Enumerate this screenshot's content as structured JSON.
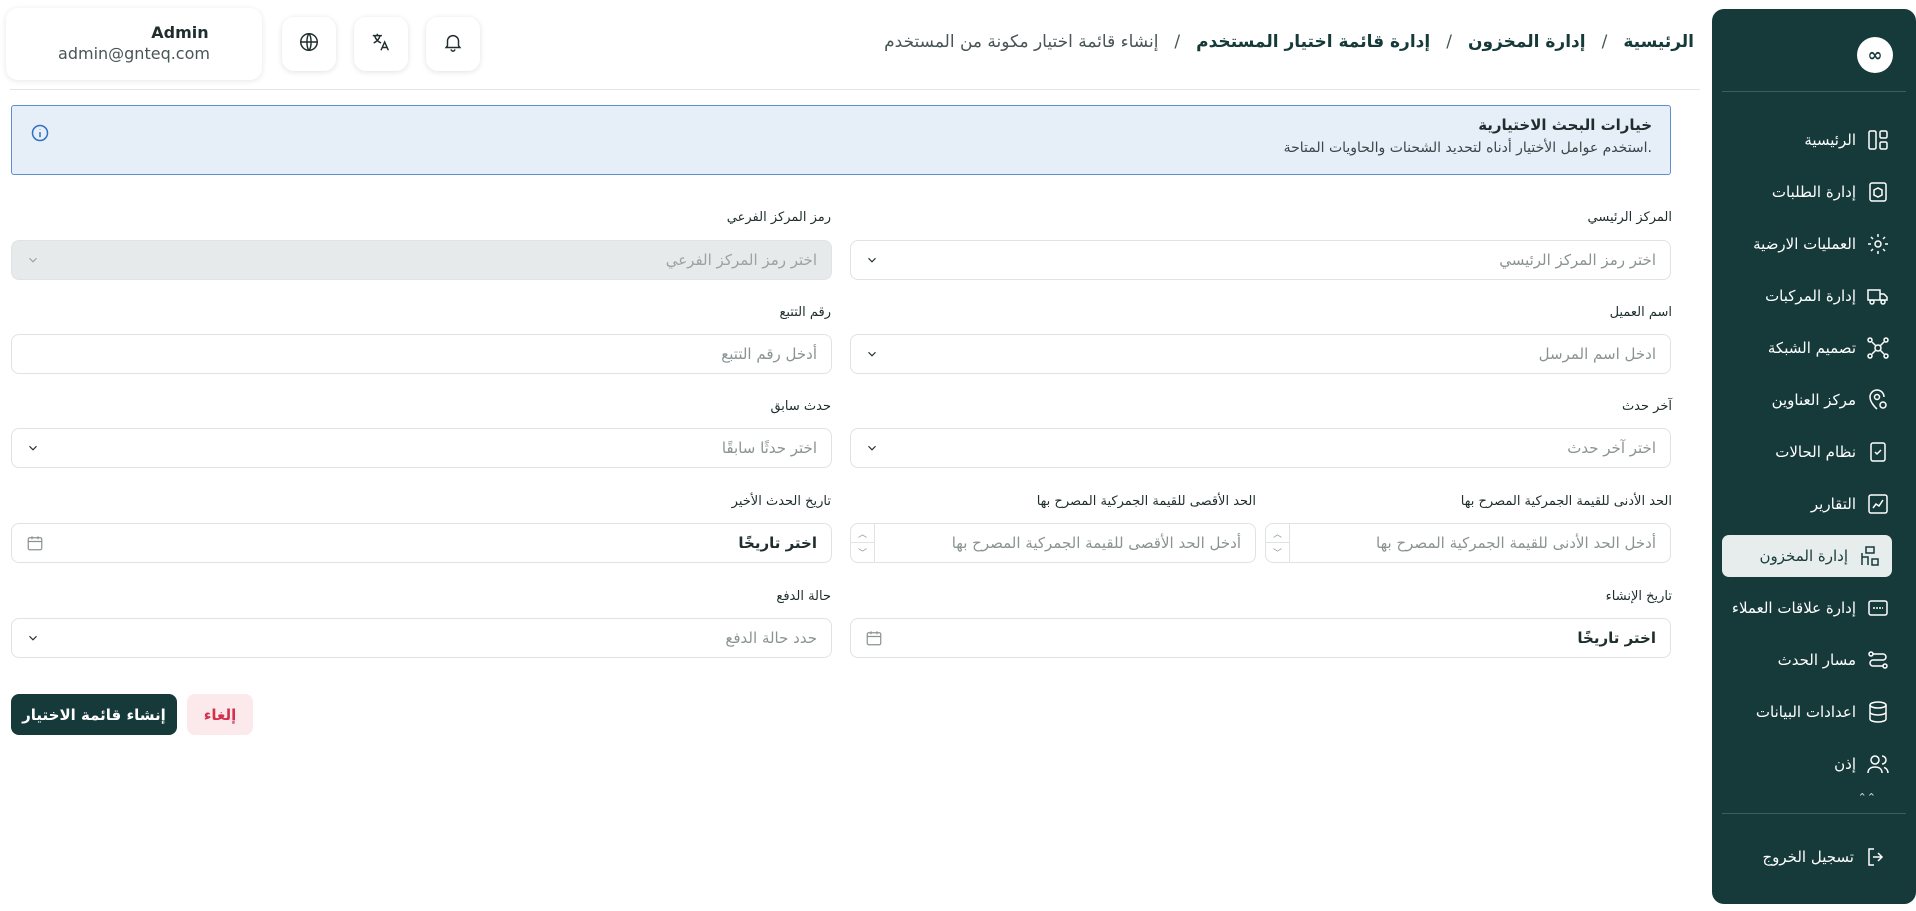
{
  "sidebar": {
    "logo": "∞",
    "items": [
      {
        "label": "الرئيسية",
        "icon": "dashboard-icon"
      },
      {
        "label": "إدارة الطلبات",
        "icon": "orders-icon"
      },
      {
        "label": "العمليات الارضية",
        "icon": "ground-operations-icon"
      },
      {
        "label": "إدارة المركبات",
        "icon": "truck-icon"
      },
      {
        "label": "تصميم الشبكة",
        "icon": "network-icon"
      },
      {
        "label": "مركز العناوين",
        "icon": "location-icon"
      },
      {
        "label": "نظام الحالات",
        "icon": "status-icon"
      },
      {
        "label": "التقارير",
        "icon": "reports-icon"
      },
      {
        "label": "إدارة المخزون",
        "icon": "inventory-icon",
        "active": true
      },
      {
        "label": "إدارة علاقات العملاء",
        "icon": "crm-icon"
      },
      {
        "label": "مسار الحدث",
        "icon": "event-path-icon"
      },
      {
        "label": "اعدادات البيانات",
        "icon": "database-icon"
      },
      {
        "label": "إذن",
        "icon": "users-icon"
      }
    ],
    "more": "⌃⌃",
    "logout": "تسجيل الخروج"
  },
  "header": {
    "breadcrumb": [
      "الرئيسية",
      "إدارة المخزون",
      "إدارة قائمة اختيار المستخدم",
      "إنشاء قائمة اختيار مكونة من المستخدم"
    ],
    "separator": "/",
    "user": {
      "name": "Admin",
      "email": "admin@gnteq.com"
    }
  },
  "alert": {
    "title": "خيارات البحث الاختيارية",
    "text": "استخدم عوامل الأختيار أدناه لتحديد الشحنات والحاويات المتاحة."
  },
  "form": {
    "main_center": {
      "label": "المركز الرئيسي",
      "placeholder": "اختر رمز المركز الرئيسي"
    },
    "sub_center": {
      "label": "رمز المركز الفرعي",
      "placeholder": "اختر رمز المركز الفرعي"
    },
    "customer_name": {
      "label": "اسم العميل",
      "placeholder": "ادخل اسم المرسل"
    },
    "tracking_number": {
      "label": "رقم التتبع",
      "placeholder": "أدخل رقم التتبع"
    },
    "last_event": {
      "label": "آخر حدث",
      "placeholder": "اختر آخر حدث"
    },
    "previous_event": {
      "label": "حدث سابق",
      "placeholder": "اختر حدثًا سابقًا"
    },
    "min_customs": {
      "label": "الحد الأدنى للقيمة الجمركية المصرح بها",
      "placeholder": "أدخل الحد الأدنى للقيمة الجمركية المصرح بها"
    },
    "max_customs": {
      "label": "الحد الأقصى للقيمة الجمركية المصرح بها",
      "placeholder": "أدخل الحد الأقصى للقيمة الجمركية المصرح بها"
    },
    "last_event_date": {
      "label": "تاريخ الحدث الأخير",
      "value": "اختر تاريخًا"
    },
    "creation_date": {
      "label": "تاريخ الإنشاء",
      "value": "اختر تاريخًا"
    },
    "payment_status": {
      "label": "حالة الدفع",
      "placeholder": "حدد حالة الدفع"
    }
  },
  "actions": {
    "create": "إنشاء قائمة الاختيار",
    "cancel": "إلغاء"
  }
}
